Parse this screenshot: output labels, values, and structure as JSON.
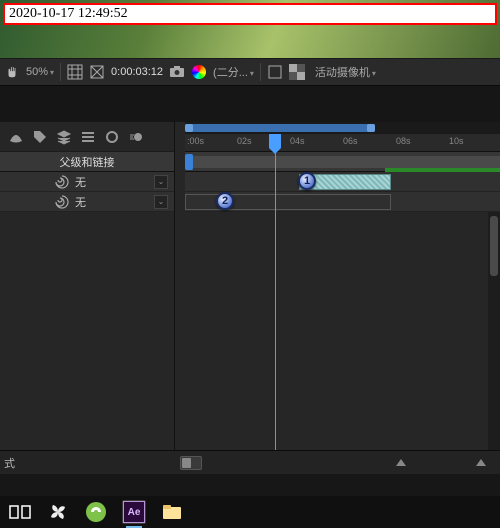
{
  "timestamp": "2020-10-17 12:49:52",
  "toolbar": {
    "zoom": "50%",
    "timecode": "0:00:03:12",
    "preview_quality": "(二分...",
    "camera": "活动摄像机"
  },
  "panel": {
    "header": "父级和链接",
    "rows": [
      {
        "parent": "无"
      },
      {
        "parent": "无"
      }
    ]
  },
  "timeline": {
    "ticks": [
      ":00s",
      "02s",
      "04s",
      "06s",
      "08s",
      "10s"
    ],
    "markers": [
      {
        "label": "1"
      },
      {
        "label": "2"
      }
    ]
  },
  "status": {
    "mode_label": "式"
  },
  "taskbar": {
    "ae_label": "Ae"
  }
}
